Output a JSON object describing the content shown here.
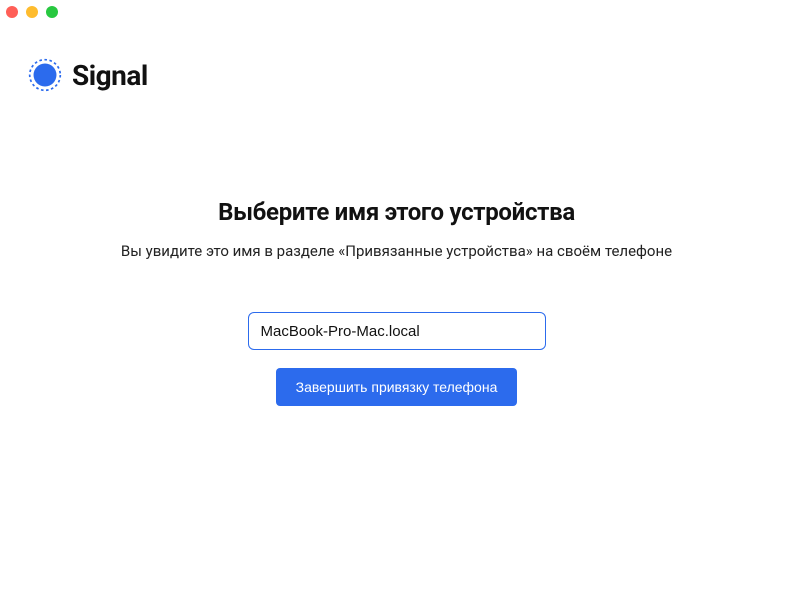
{
  "brand": {
    "name": "Signal",
    "accent": "#2c6bed"
  },
  "window": {
    "traffic_close": "close",
    "traffic_min": "minimize",
    "traffic_max": "maximize"
  },
  "link": {
    "title": "Выберите имя этого устройства",
    "subtitle": "Вы увидите это имя в разделе «Привязанные устройства» на своём телефоне",
    "device_name_value": "MacBook-Pro-Mac.local",
    "device_name_placeholder": "",
    "finish_button_label": "Завершить привязку телефона"
  }
}
